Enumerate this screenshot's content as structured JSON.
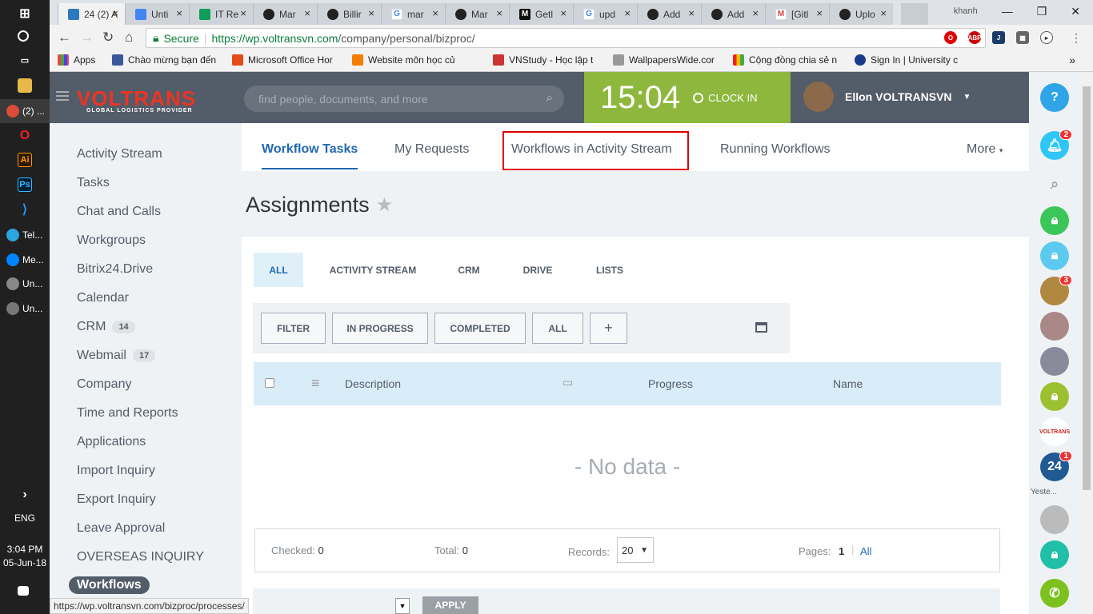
{
  "taskbar": {
    "apps": [
      {
        "label": "(2) ..."
      },
      {
        "label": "Tel..."
      },
      {
        "label": "Me..."
      },
      {
        "label": "Un..."
      },
      {
        "label": "Un..."
      }
    ],
    "lang": "ENG",
    "time": "3:04 PM",
    "date": "05-Jun-18"
  },
  "browser": {
    "tabs": [
      {
        "label": "24  (2) A"
      },
      {
        "label": "Unti"
      },
      {
        "label": "IT Re"
      },
      {
        "label": "Mar"
      },
      {
        "label": "Billir"
      },
      {
        "label": "mar"
      },
      {
        "label": "Mar"
      },
      {
        "label": "Getl"
      },
      {
        "label": "upd"
      },
      {
        "label": "Add"
      },
      {
        "label": "Add"
      },
      {
        "label": "[Gitl"
      },
      {
        "label": "Uplo"
      }
    ],
    "profile": "khanh",
    "secure_label": "Secure",
    "url_host": "https://wp.voltransvn.com",
    "url_path": "/company/personal/bizproc/",
    "bookmarks": [
      {
        "label": "Apps"
      },
      {
        "label": "Chào mừng bạn đến"
      },
      {
        "label": "Microsoft Office Hor"
      },
      {
        "label": "Website môn học củ"
      },
      {
        "label": "VNStudy - Học lập t"
      },
      {
        "label": "WallpapersWide.cor"
      },
      {
        "label": "Cộng đồng chia sẻ n"
      },
      {
        "label": "Sign In | University c"
      }
    ],
    "status_url": "https://wp.voltransvn.com/bizproc/processes/"
  },
  "header": {
    "logo": "VOLTRANS",
    "logo_sub": "GLOBAL LOGISTICS PROVIDER",
    "search_placeholder": "find people, documents, and more",
    "clock_time": "15:04",
    "clock_in_label": "CLOCK IN",
    "user_name": "Ellon VOLTRANSVN"
  },
  "leftmenu": {
    "items": [
      {
        "label": "Activity Stream"
      },
      {
        "label": "Tasks"
      },
      {
        "label": "Chat and Calls"
      },
      {
        "label": "Workgroups"
      },
      {
        "label": "Bitrix24.Drive"
      },
      {
        "label": "Calendar"
      },
      {
        "label": "CRM",
        "count": "14"
      },
      {
        "label": "Webmail",
        "count": "17"
      },
      {
        "label": "Company"
      },
      {
        "label": "Time and Reports"
      },
      {
        "label": "Applications"
      },
      {
        "label": "Import Inquiry"
      },
      {
        "label": "Export Inquiry"
      },
      {
        "label": "Leave Approval"
      },
      {
        "label": "OVERSEAS INQUIRY"
      },
      {
        "label": "Workflows"
      }
    ]
  },
  "main": {
    "tabs": [
      {
        "label": "Workflow Tasks"
      },
      {
        "label": "My Requests"
      },
      {
        "label": "Workflows in Activity Stream"
      },
      {
        "label": "Running Workflows"
      },
      {
        "label": "More"
      }
    ],
    "title": "Assignments",
    "filter_tabs": [
      {
        "label": "ALL"
      },
      {
        "label": "ACTIVITY STREAM"
      },
      {
        "label": "CRM"
      },
      {
        "label": "DRIVE"
      },
      {
        "label": "LISTS"
      }
    ],
    "filter_buttons": [
      {
        "label": "FILTER"
      },
      {
        "label": "IN PROGRESS"
      },
      {
        "label": "COMPLETED"
      },
      {
        "label": "ALL"
      },
      {
        "label": "+"
      }
    ],
    "columns": {
      "description": "Description",
      "progress": "Progress",
      "name": "Name"
    },
    "no_data": "- No data -",
    "footer": {
      "checked_label": "Checked:",
      "checked_value": "0",
      "total_label": "Total:",
      "total_value": "0",
      "records_label": "Records:",
      "records_value": "20",
      "pages_label": "Pages:",
      "page_current": "1",
      "page_all": "All"
    },
    "apply_label": "APPLY"
  },
  "rightbar": {
    "help": "?",
    "notif_badge": "2",
    "avatar1_badge": "3",
    "b24_badge": "1",
    "b24_label": "24",
    "yesterday": "Yeste..."
  }
}
